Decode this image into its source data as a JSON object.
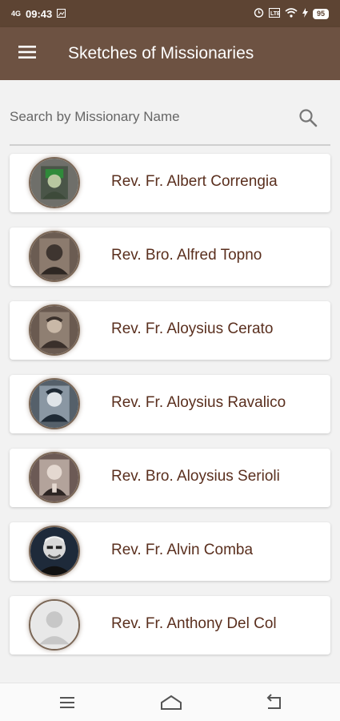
{
  "status_bar": {
    "signal": "4G",
    "time": "09:43",
    "battery": "95"
  },
  "app_bar": {
    "title": "Sketches of Missionaries"
  },
  "search": {
    "placeholder": "Search by Missionary Name"
  },
  "missionaries": [
    {
      "name": "Rev. Fr. Albert Correngia",
      "photo": "green-portrait"
    },
    {
      "name": "Rev. Bro. Alfred Topno",
      "photo": "sepia-portrait"
    },
    {
      "name": "Rev. Fr. Aloysius Cerato",
      "photo": "sepia-portrait"
    },
    {
      "name": "Rev. Fr. Aloysius Ravalico",
      "photo": "blue-portrait"
    },
    {
      "name": "Rev. Bro. Aloysius Serioli",
      "photo": "sepia-portrait"
    },
    {
      "name": "Rev. Fr. Alvin Comba",
      "photo": "bw-portrait"
    },
    {
      "name": "Rev. Fr. Anthony Del Col",
      "photo": "placeholder-avatar"
    }
  ],
  "nav_bar": {
    "icons": [
      "recent-apps-icon",
      "home-icon",
      "back-icon"
    ]
  }
}
